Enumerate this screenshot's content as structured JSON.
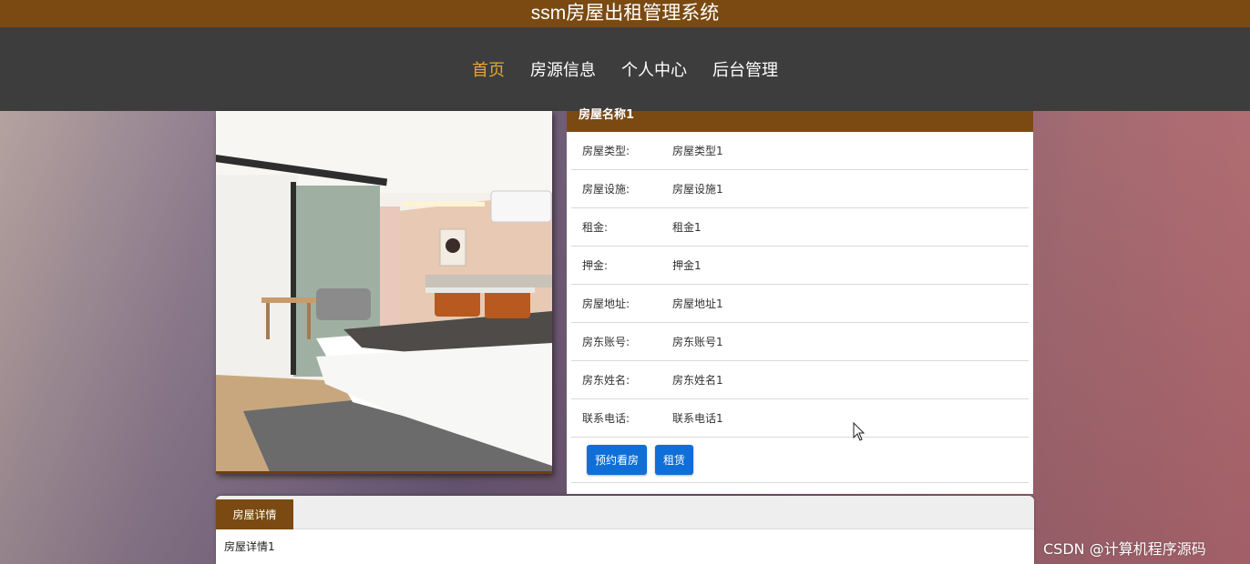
{
  "header": {
    "title": "ssm房屋出租管理系统"
  },
  "nav": {
    "items": [
      {
        "label": "首页",
        "active": true
      },
      {
        "label": "房源信息",
        "active": false
      },
      {
        "label": "个人中心",
        "active": false
      },
      {
        "label": "后台管理",
        "active": false
      }
    ]
  },
  "house": {
    "name": "房屋名称1",
    "fields": [
      {
        "key": "房屋类型:",
        "value": "房屋类型1"
      },
      {
        "key": "房屋设施:",
        "value": "房屋设施1"
      },
      {
        "key": "租金:",
        "value": "租金1"
      },
      {
        "key": "押金:",
        "value": "押金1"
      },
      {
        "key": "房屋地址:",
        "value": "房屋地址1"
      },
      {
        "key": "房东账号:",
        "value": "房东账号1"
      },
      {
        "key": "房东姓名:",
        "value": "房东姓名1"
      },
      {
        "key": "联系电话:",
        "value": "联系电话1"
      }
    ],
    "actions": {
      "book_label": "预约看房",
      "rent_label": "租赁"
    }
  },
  "detail": {
    "tab_label": "房屋详情",
    "content": "房屋详情1"
  },
  "watermark": "CSDN @计算机程序源码",
  "colors": {
    "brand": "#7a4a12",
    "nav_bg": "#3d3d3d",
    "active": "#e3a92e",
    "button": "#0f6fd9"
  }
}
